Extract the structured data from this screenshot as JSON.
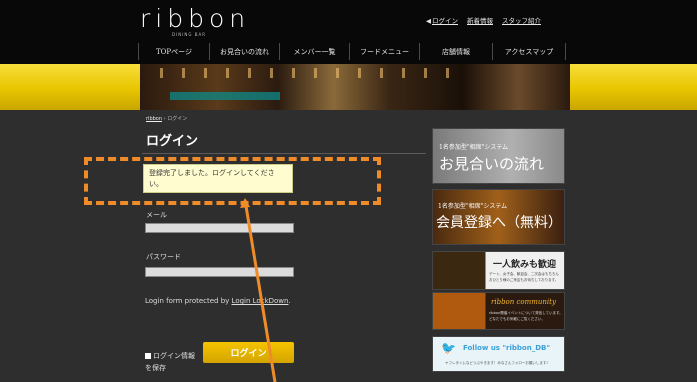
{
  "header": {
    "logo": "ribbon",
    "logo_sub": "DINING BAR",
    "top_links": {
      "login": "ログイン",
      "news": "新着情報",
      "staff": "スタッフ紹介"
    }
  },
  "nav": {
    "items": [
      "TOPページ",
      "お見合いの流れ",
      "メンバー一覧",
      "フードメニュー",
      "店舗情報",
      "アクセスマップ"
    ]
  },
  "breadcrumb": {
    "home": "ribbon",
    "sep": "›",
    "current": "ログイン"
  },
  "page": {
    "title": "ログイン"
  },
  "notice": {
    "text": "登録完了しました。ログインしてください。"
  },
  "form": {
    "email_label": "メール",
    "password_label": "パスワード",
    "protect_prefix": "Login form protected by ",
    "protect_link": "Login LockDown",
    "protect_suffix": ".",
    "remember_line1": "ログイン情報",
    "remember_line2": "を保存",
    "login_button": "ログイン"
  },
  "sidebar": {
    "banner1": {
      "line1": "1名参加型\"相席\"システム",
      "line2": "お見合いの流れ"
    },
    "banner2": {
      "line1": "1名参加型\"相席\"システム",
      "line2": "会員登録へ（無料）"
    },
    "banner3": {
      "title": "一人飲みも歓迎",
      "text1": "デート、女子会、歓迎会、二次会はもちろん",
      "text2": "おひとり様のご来店もお待ちしております。"
    },
    "banner4": {
      "title": "ribbon community",
      "text1": "ribbon開催イベントについて発信しています。",
      "text2": "どなたでもお気軽にご覧ください。"
    },
    "banner5": {
      "title": "Follow us \"ribbon_DB\"",
      "text": "ヤフレタイムなどつぶやきます！みなさんフォローお願いします♪"
    }
  },
  "colors": {
    "accent_yellow": "#e8c500",
    "annotation_orange": "#f08b2a",
    "header_black": "#080808",
    "content_gray": "#2e2e2e"
  }
}
